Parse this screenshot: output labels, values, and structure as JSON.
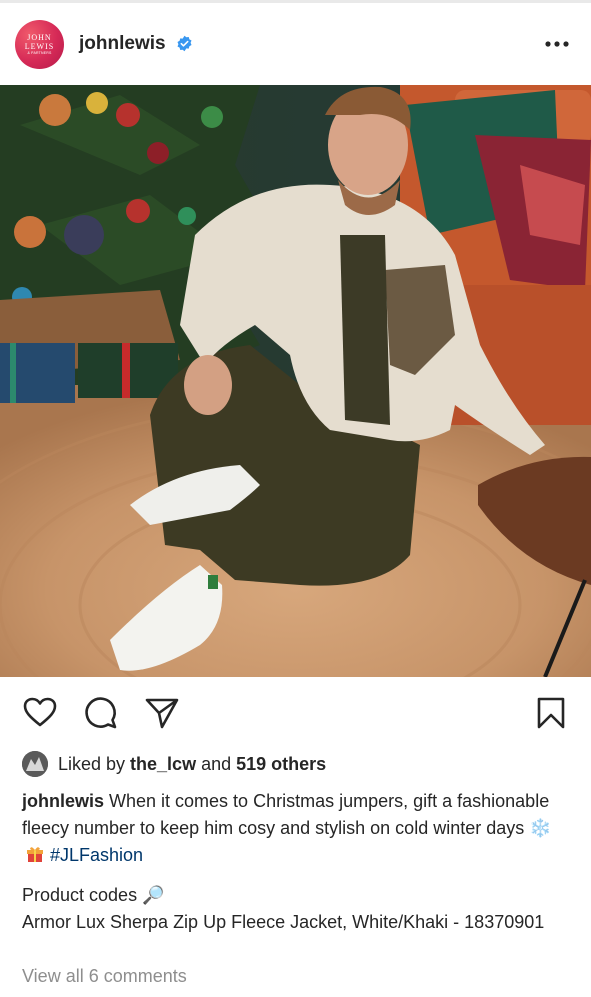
{
  "post": {
    "avatar_text": [
      "JOHN",
      "LEWIS",
      "& PARTNERS"
    ],
    "username": "johnlewis",
    "verified_icon": "verified-badge-icon",
    "more_icon": "more-horizontal-icon"
  },
  "actions": {
    "like_icon": "heart-icon",
    "comment_icon": "comment-icon",
    "share_icon": "paper-plane-icon",
    "save_icon": "bookmark-icon"
  },
  "likes": {
    "prefix": "Liked by ",
    "user": "the_lcw",
    "middle": " and ",
    "others": "519 others"
  },
  "caption": {
    "username": "johnlewis",
    "text": " When it comes to Christmas jumpers, gift a fashionable fleecy number to keep him cosy and stylish on cold winter days ",
    "emoji_snow": "❄️",
    "emoji_gift": "🎁",
    "hashtag": "#JLFashion"
  },
  "product": {
    "heading": "Product codes ",
    "emoji": "🔎",
    "line": "Armor Lux Sherpa Zip Up Fleece Jacket, White/Khaki - 18370901"
  },
  "comments": {
    "link": "View all 6 comments"
  },
  "colors": {
    "brand": "#d62a57",
    "verified": "#3897f0",
    "hashtag": "#00376b",
    "muted": "#8e8e8e"
  }
}
